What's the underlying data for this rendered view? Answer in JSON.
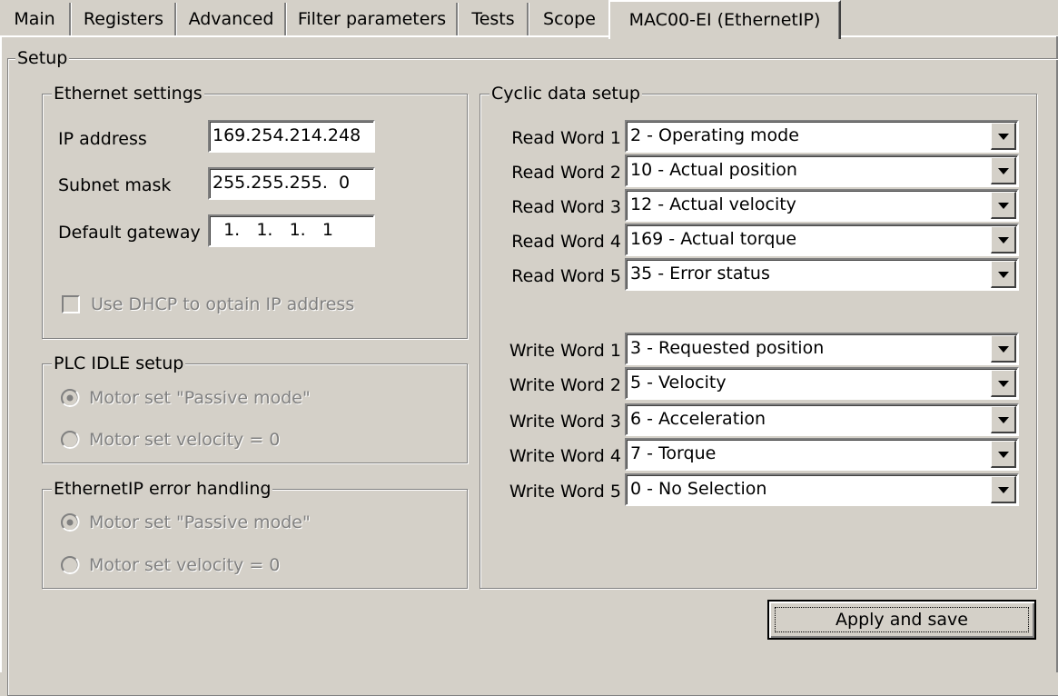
{
  "tabs": [
    {
      "label": "Main"
    },
    {
      "label": "Registers"
    },
    {
      "label": "Advanced"
    },
    {
      "label": "Filter parameters"
    },
    {
      "label": "Tests"
    },
    {
      "label": "Scope"
    },
    {
      "label": "MAC00-EI (EthernetIP)",
      "active": true
    }
  ],
  "setup": {
    "title": "Setup",
    "ethernet": {
      "title": "Ethernet settings",
      "ip_label": "IP address",
      "ip_value": "169.254.214.248",
      "subnet_label": "Subnet mask",
      "subnet_value": "255.255.255.  0",
      "gateway_label": "Default gateway",
      "gateway_value": "  1.   1.   1.   1",
      "dhcp_label": "Use DHCP to optain IP address",
      "dhcp_checked": false
    },
    "plc_idle": {
      "title": "PLC IDLE setup",
      "option1": "Motor set \"Passive mode\"",
      "option2": "Motor set velocity = 0",
      "selected": 1
    },
    "error_handling": {
      "title": "EthernetIP error handling",
      "option1": "Motor set \"Passive mode\"",
      "option2": "Motor set velocity = 0",
      "selected": 1
    },
    "cyclic": {
      "title": "Cyclic data setup",
      "read": [
        {
          "label": "Read Word 1",
          "value": "2 - Operating mode"
        },
        {
          "label": "Read Word 2",
          "value": "10 - Actual position"
        },
        {
          "label": "Read Word 3",
          "value": "12 - Actual velocity"
        },
        {
          "label": "Read Word 4",
          "value": "169 - Actual torque"
        },
        {
          "label": "Read Word 5",
          "value": "35 - Error status"
        }
      ],
      "write": [
        {
          "label": "Write Word 1",
          "value": "3 - Requested position"
        },
        {
          "label": "Write Word 2",
          "value": "5 - Velocity"
        },
        {
          "label": "Write Word 3",
          "value": "6 - Acceleration"
        },
        {
          "label": "Write Word 4",
          "value": "7 - Torque"
        },
        {
          "label": "Write Word 5",
          "value": "0 - No Selection"
        }
      ]
    },
    "apply_label": "Apply and save"
  }
}
